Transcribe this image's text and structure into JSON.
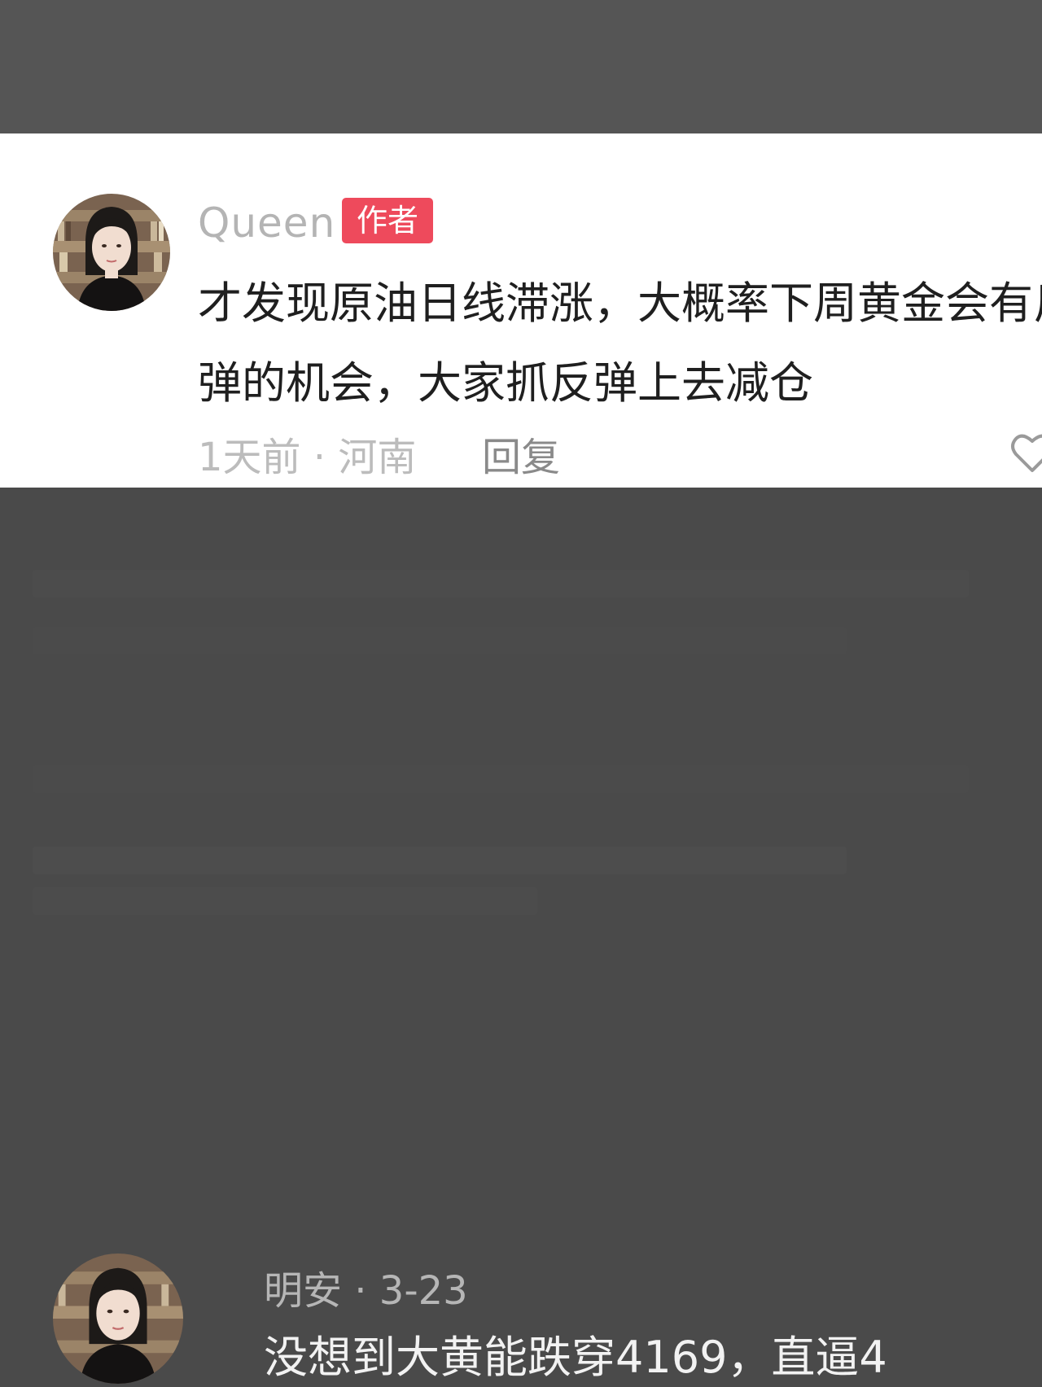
{
  "top_comment": {
    "username": "Queen",
    "badge": "作者",
    "text": "才发现原油日线滞涨，大概率下周黄金会有反弹的机会，大家抓反弹上去减仓",
    "time_location": "1天前 · 河南",
    "reply_label": "回复",
    "like_icon": "heart-outline-icon"
  },
  "bottom_comment": {
    "user_date": "明安 · 3-23",
    "text": "没想到大黄能跌穿4169，直逼4"
  },
  "colors": {
    "badge": "#ee4a5c",
    "overlay": "#4a4a4a",
    "card": "#ffffff"
  }
}
